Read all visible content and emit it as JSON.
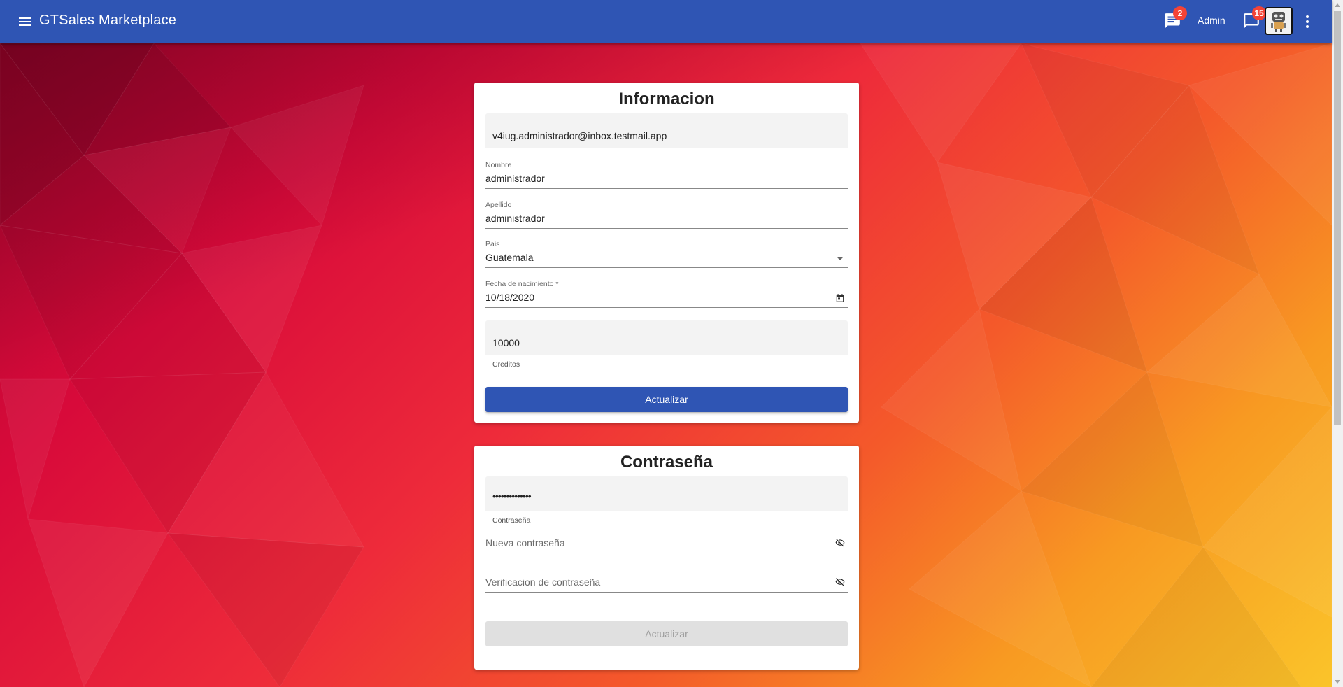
{
  "header": {
    "app_title": "GTSales Marketplace",
    "notifications_badge": "2",
    "user_label": "Admin",
    "messages_badge": "15"
  },
  "info_card": {
    "title": "Informacion",
    "email_value": "v4iug.administrador@inbox.testmail.app",
    "nombre_label": "Nombre",
    "nombre_value": "administrador",
    "apellido_label": "Apellido",
    "apellido_value": "administrador",
    "pais_label": "Pais",
    "pais_value": "Guatemala",
    "fecha_label": "Fecha de nacimiento *",
    "fecha_value": "10/18/2020",
    "creditos_value": "10000",
    "creditos_helper": "Creditos",
    "submit_label": "Actualizar"
  },
  "password_card": {
    "title": "Contraseña",
    "password_value": "••••••••••••••",
    "password_helper": "Contraseña",
    "new_password_placeholder": "Nueva contraseña",
    "verify_password_placeholder": "Verificacion de contraseña",
    "submit_label": "Actualizar"
  },
  "colors": {
    "primary": "#2f55b4",
    "badge": "#f44336",
    "disabled_button": "#e0e0e0"
  },
  "icons": [
    "menu-icon",
    "chat-icon",
    "robot-avatar-icon",
    "more-vert-icon",
    "dropdown-arrow-icon",
    "calendar-icon",
    "visibility-off-icon"
  ]
}
